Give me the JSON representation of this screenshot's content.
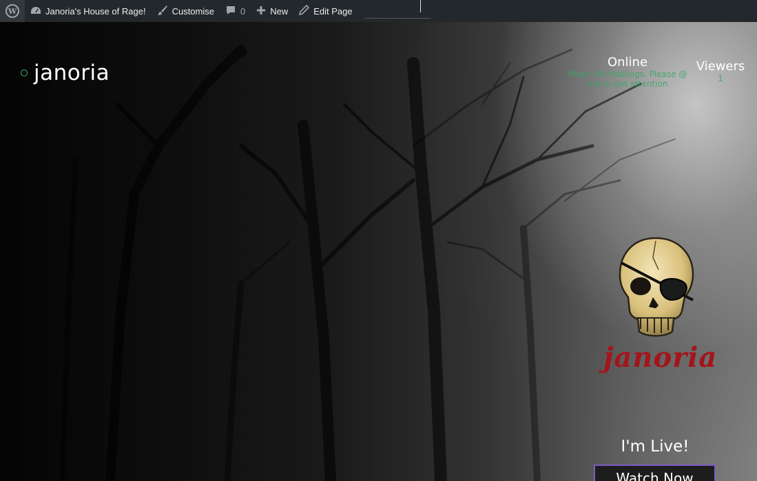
{
  "adminbar": {
    "wp_logo_icon": "wordpress-logo-icon",
    "site_name": "Janoria's House of Rage!",
    "customise_label": "Customise",
    "comments_count": "0",
    "new_label": "New",
    "edit_page_label": "Edit Page"
  },
  "hero": {
    "brand_name": "janoria",
    "online": {
      "title": "Online",
      "subtitle": "Mixer API fiddlings. Please @ me to get attention"
    },
    "viewers": {
      "title": "Viewers",
      "count": "1"
    },
    "logo_text": "janoria",
    "live_label": "I'm Live!",
    "watch_button": "Watch Now"
  },
  "colors": {
    "adminbar_bg": "#23282d",
    "status_green": "#3cba6c",
    "button_border": "#7d5bc5",
    "logo_red": "#a3151b"
  }
}
